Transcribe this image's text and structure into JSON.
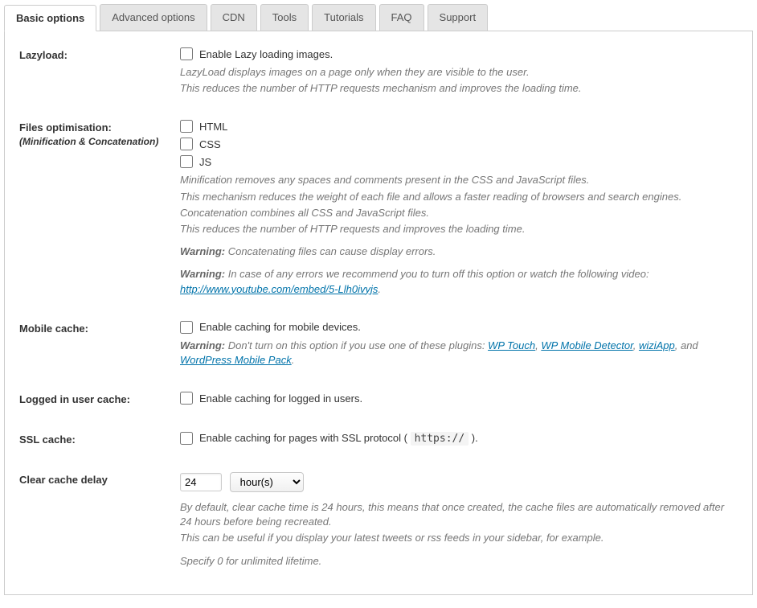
{
  "tabs": [
    {
      "label": "Basic options",
      "active": true
    },
    {
      "label": "Advanced options",
      "active": false
    },
    {
      "label": "CDN",
      "active": false
    },
    {
      "label": "Tools",
      "active": false
    },
    {
      "label": "Tutorials",
      "active": false
    },
    {
      "label": "FAQ",
      "active": false
    },
    {
      "label": "Support",
      "active": false
    }
  ],
  "lazyload": {
    "label": "Lazyload:",
    "checkbox": "Enable Lazy loading images.",
    "desc1": "LazyLoad displays images on a page only when they are visible to the user.",
    "desc2": "This reduces the number of HTTP requests mechanism and improves the loading time."
  },
  "filesopt": {
    "label": "Files optimisation:",
    "sublabel": "(Minification & Concatenation)",
    "html": "HTML",
    "css": "CSS",
    "js": "JS",
    "d1": "Minification removes any spaces and comments present in the CSS and JavaScript files.",
    "d2": "This mechanism reduces the weight of each file and allows a faster reading of browsers and search engines.",
    "d3": "Concatenation combines all CSS and JavaScript files.",
    "d4": "This reduces the number of HTTP requests and improves the loading time.",
    "warnLabel": "Warning:",
    "w1": " Concatenating files can cause display errors.",
    "w2": " In case of any errors we recommend you to turn off this option or watch the following video: ",
    "link": "http://www.youtube.com/embed/5-Llh0ivyjs",
    "period": "."
  },
  "mobile": {
    "label": "Mobile cache:",
    "checkbox": "Enable caching for mobile devices.",
    "warnLabel": "Warning:",
    "w1a": " Don't turn on this option if you use one of these plugins: ",
    "l1": "WP Touch",
    "l2": "WP Mobile Detector",
    "l3": "wiziApp",
    "l4": "WordPress Mobile Pack",
    "sep": ", ",
    "and": ", and ",
    "period": "."
  },
  "logged": {
    "label": "Logged in user cache:",
    "checkbox": "Enable caching for logged in users."
  },
  "ssl": {
    "label": "SSL cache:",
    "cb1": "Enable caching for pages with SSL protocol ( ",
    "code": "https://",
    "cb2": " )."
  },
  "clear": {
    "label": "Clear cache delay",
    "value": "24",
    "unit": "hour(s)",
    "d1": "By default, clear cache time is 24 hours, this means that once created, the cache files are automatically removed after 24 hours before being recreated.",
    "d2": "This can be useful if you display your latest tweets or rss feeds in your sidebar, for example.",
    "d3": "Specify 0 for unlimited lifetime."
  }
}
